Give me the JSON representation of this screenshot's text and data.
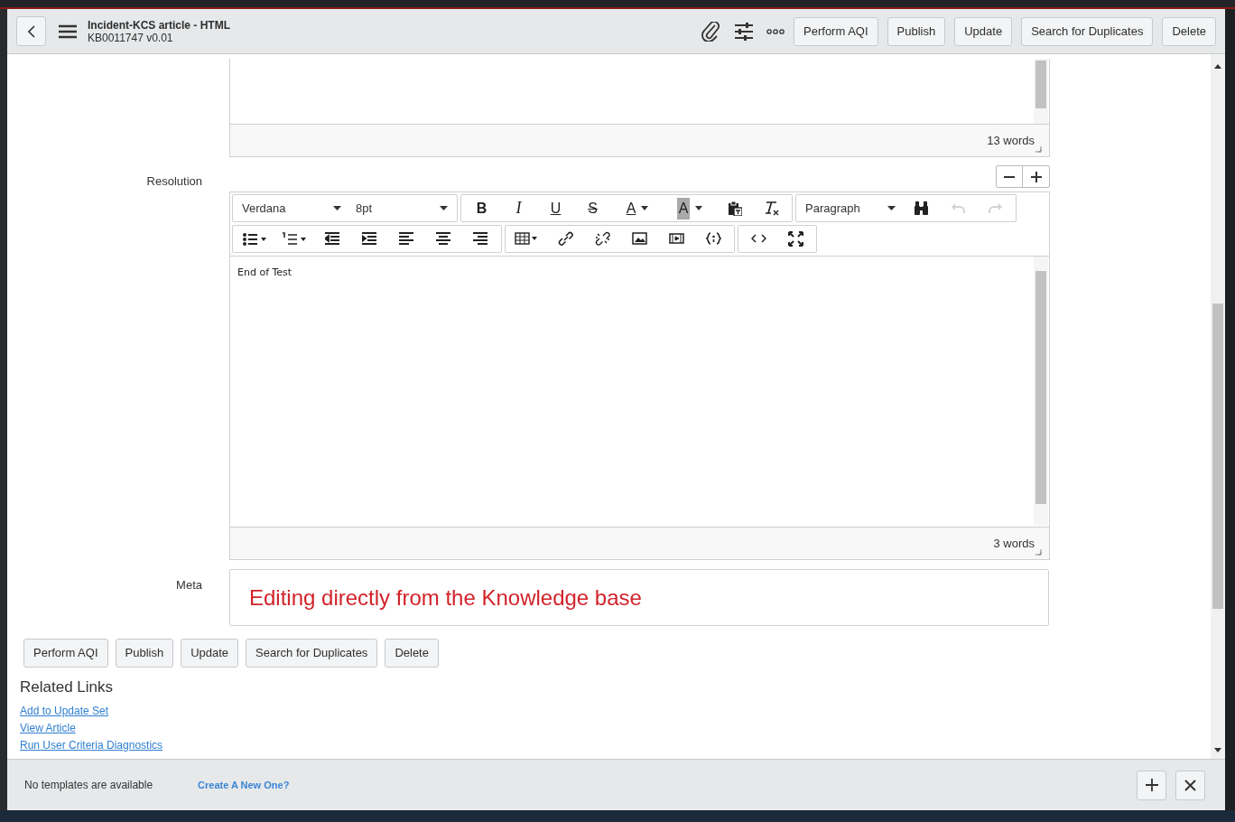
{
  "header": {
    "title": "Incident-KCS article - HTML",
    "subtitle": "KB0011747 v0.01",
    "buttons": [
      "Perform AQI",
      "Publish",
      "Update",
      "Search for Duplicates",
      "Delete"
    ]
  },
  "top_editor": {
    "word_count": "13 words"
  },
  "resolution": {
    "label": "Resolution",
    "toolbar_rows": [
      [
        [
          {
            "kind": "select",
            "text": "Verdana"
          },
          {
            "kind": "select",
            "text": "8pt"
          }
        ],
        [
          {
            "kind": "glyph",
            "text": "B"
          },
          {
            "kind": "glyph",
            "text": "I"
          },
          {
            "kind": "glyph",
            "text": "U"
          },
          {
            "kind": "glyph",
            "text": "S"
          },
          {
            "kind": "glyph",
            "text": "A"
          },
          {
            "kind": "glyph",
            "text": "A"
          },
          {
            "kind": "icon"
          },
          {
            "kind": "icon"
          }
        ],
        [
          {
            "kind": "select",
            "text": "Paragraph"
          },
          {
            "kind": "icon"
          },
          {
            "kind": "icon",
            "disabled": true
          },
          {
            "kind": "icon",
            "disabled": true
          }
        ]
      ],
      [
        [
          {
            "kind": "icon"
          },
          {
            "kind": "icon"
          },
          {
            "kind": "icon"
          },
          {
            "kind": "icon"
          },
          {
            "kind": "icon"
          },
          {
            "kind": "icon"
          },
          {
            "kind": "icon"
          }
        ],
        [
          {
            "kind": "icon"
          },
          {
            "kind": "icon"
          },
          {
            "kind": "icon"
          },
          {
            "kind": "icon"
          },
          {
            "kind": "icon"
          },
          {
            "kind": "icon"
          }
        ],
        [
          {
            "kind": "icon"
          },
          {
            "kind": "icon"
          }
        ]
      ]
    ],
    "content": "End of Test",
    "word_count": "3 words"
  },
  "meta": {
    "label": "Meta",
    "value": "Editing directly from the Knowledge base"
  },
  "form_buttons": [
    "Perform AQI",
    "Publish",
    "Update",
    "Search for Duplicates",
    "Delete"
  ],
  "related_links": {
    "title": "Related Links",
    "links": [
      "Add to Update Set",
      "View Article",
      "Run User Criteria Diagnostics"
    ]
  },
  "footer": {
    "message": "No templates are available",
    "link": "Create A New One?"
  }
}
